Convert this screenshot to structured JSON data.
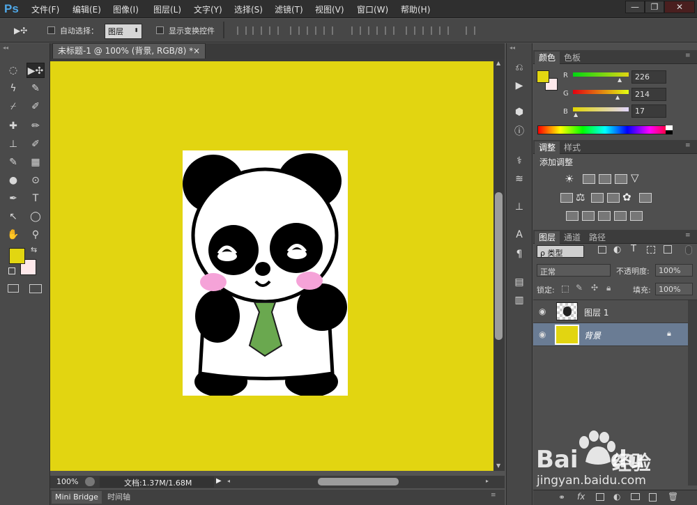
{
  "app": {
    "logo": "Ps",
    "menu": [
      "文件(F)",
      "编辑(E)",
      "图像(I)",
      "图层(L)",
      "文字(Y)",
      "选择(S)",
      "滤镜(T)",
      "视图(V)",
      "窗口(W)",
      "帮助(H)"
    ],
    "window_controls": [
      "—",
      "❐",
      "✕"
    ]
  },
  "options_bar": {
    "tool_glyph": "▶✣",
    "auto_select_label": "自动选择：",
    "auto_select_value": "图层",
    "show_transform_label": "显示变换控件"
  },
  "document": {
    "tab_title": "未标题-1 @ 100% (背景, RGB/8) *",
    "tab_close": "×",
    "canvas_color": "#e2d511",
    "zoom": "100%",
    "doc_info": "文档:1.37M/1.68M"
  },
  "bottom_tabs": [
    "Mini Bridge",
    "时间轴"
  ],
  "tools": [
    [
      "◌",
      "▶✣"
    ],
    [
      "ϟ",
      "✎"
    ],
    [
      "⌿",
      "✐"
    ],
    [
      "✚",
      "✏"
    ],
    [
      "⊥",
      "✐"
    ],
    [
      "✎",
      "▦"
    ],
    [
      "●",
      "⊙"
    ],
    [
      "✒",
      "T"
    ],
    [
      "↖",
      "◯"
    ],
    [
      "✋",
      "⚲"
    ]
  ],
  "colors": {
    "foreground": "#e2d611",
    "background": "#fde8ea",
    "accent": "#e2d511"
  },
  "color_panel": {
    "tabs": [
      "颜色",
      "色板"
    ],
    "channels": [
      {
        "label": "R",
        "value": "226"
      },
      {
        "label": "G",
        "value": "214"
      },
      {
        "label": "B",
        "value": "17"
      }
    ]
  },
  "adjust_panel": {
    "tabs": [
      "调整",
      "样式"
    ],
    "title": "添加调整"
  },
  "layers_panel": {
    "tabs": [
      "图层",
      "通道",
      "路径"
    ],
    "filter_label": "ρ 类型",
    "blend_mode": "正常",
    "opacity_label": "不透明度:",
    "opacity_value": "100%",
    "lock_label": "锁定:",
    "fill_label": "填充:",
    "fill_value": "100%",
    "layers": [
      {
        "name": "图层 1"
      },
      {
        "name": "背景"
      }
    ]
  },
  "watermark": {
    "brand": "Bai",
    "brand2": "du",
    "cn": "经验",
    "url": "jingyan.baidu.com"
  }
}
